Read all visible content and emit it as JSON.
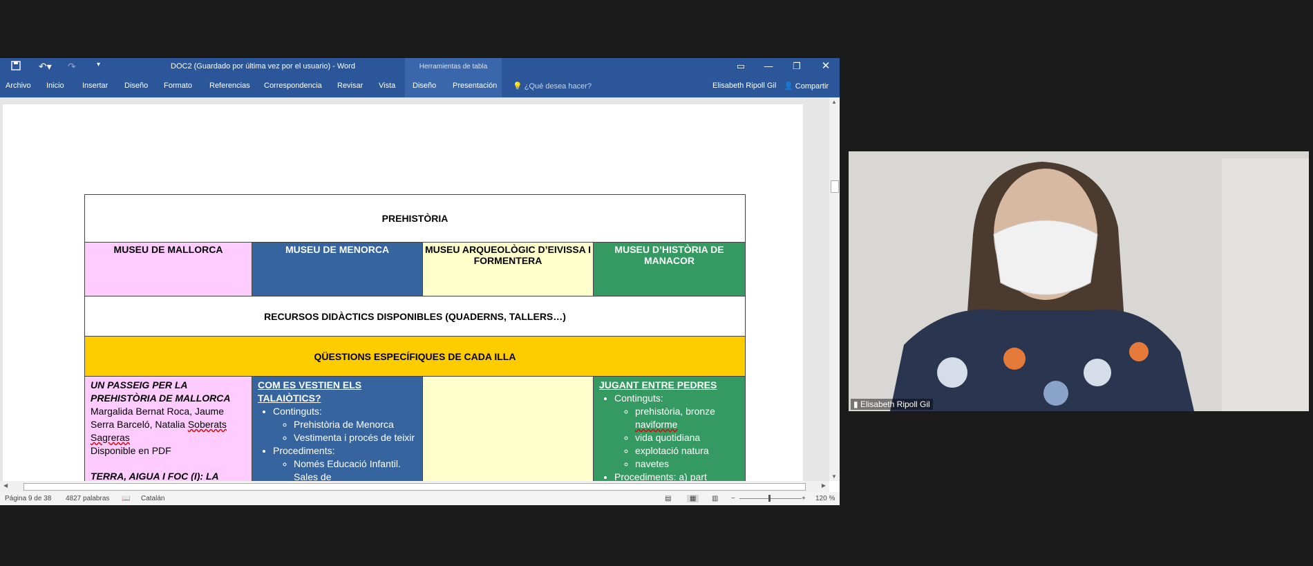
{
  "word": {
    "title": "DOC2 (Guardado por última vez por el usuario) - Word",
    "context_tab": "Herramientas de tabla",
    "tabs": [
      "Archivo",
      "Inicio",
      "Insertar",
      "Diseño",
      "Formato",
      "Referencias",
      "Correspondencia",
      "Revisar",
      "Vista",
      "Diseño",
      "Presentación"
    ],
    "tell_me": "¿Qué desea hacer?",
    "user": "Elisabeth Ripoll Gil",
    "share": "Compartir",
    "status": {
      "page": "Página 9 de 38",
      "words": "4827 palabras",
      "language": "Catalán",
      "zoom": "120 %"
    }
  },
  "table": {
    "title": "PREHISTÒRIA",
    "museums": [
      "MUSEU DE MALLORCA",
      "MUSEU DE MENORCA",
      "MUSEU ARQUEOLÒGIC D’EIVISSA I FORMENTERA",
      "MUSEU D’HISTÒRIA DE MANACOR"
    ],
    "resources": "RECURSOS DIDÀCTICS DISPONIBLES (QUADERNS, TALLERS…)",
    "questions": "QÜESTIONS ESPECÍFIQUES DE CADA ILLA",
    "col1": {
      "title": "UN PASSEIG PER LA PREHISTÒRIA DE MALLORCA",
      "authors_a": "Margalida Bernat Roca, Jaume Serra Barceló, Natalia ",
      "authors_b": "Soberats Sagreras",
      "available": "Disponible en PDF",
      "next": "TERRA, AIGUA I FOC (I): LA"
    },
    "col2": {
      "title": "COM ES VESTIEN ELS TALAIÒTICS?",
      "contents": "Continguts:",
      "items": [
        "Prehistòria de Menorca",
        "Vestimenta i procés de teixir"
      ],
      "procedures": "Procediments:",
      "proc_items": [
        "Només Educació Infantil. Sales de"
      ]
    },
    "col4": {
      "title": "JUGANT ENTRE PEDRES",
      "contents": "Continguts:",
      "items_a": "prehistòria, bronze ",
      "items_b": "naviforme",
      "items": [
        "vida quotidiana",
        "explotació natura",
        "navetes"
      ],
      "procedures": "Procediments: a) part"
    }
  },
  "video": {
    "participant": "Elisabeth Ripoll Gil"
  },
  "colors": {
    "word_blue": "#2b579a",
    "pink": "#ffccff",
    "blue": "#36649e",
    "yellow": "#ffffcc",
    "green": "#359a62",
    "orange": "#ffcc00"
  }
}
